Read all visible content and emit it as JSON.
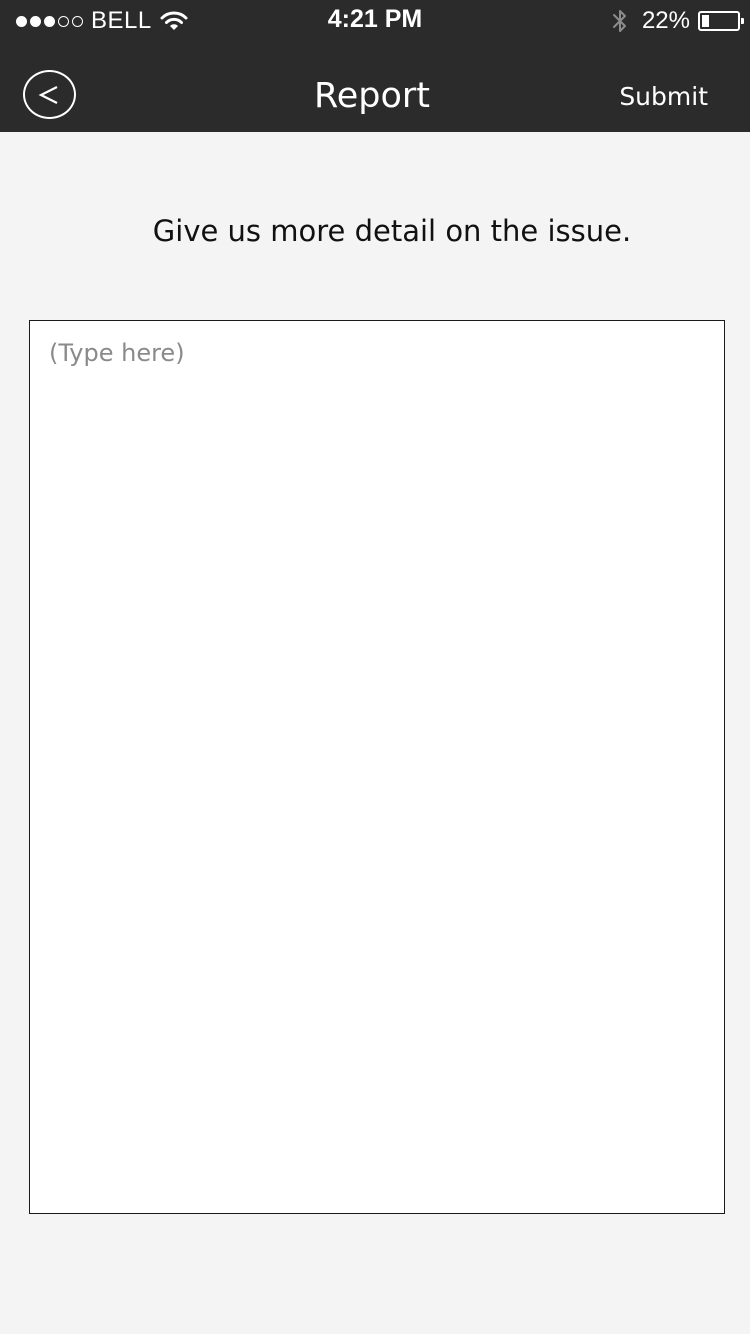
{
  "status_bar": {
    "signal_filled": 3,
    "signal_total": 5,
    "carrier": "BELL",
    "time": "4:21 PM",
    "battery_percent": "22%",
    "battery_level": 0.22,
    "icons": [
      "signal-dots-icon",
      "wifi-icon",
      "bluetooth-icon",
      "battery-icon"
    ]
  },
  "nav": {
    "back_icon": "chevron-left-icon",
    "title": "Report",
    "submit_label": "Submit"
  },
  "main": {
    "prompt": "Give us more detail on the issue.",
    "detail_placeholder": "(Type here)",
    "detail_value": ""
  },
  "colors": {
    "topbar_bg": "#2b2b2b",
    "page_bg": "#f4f4f5",
    "field_bg": "#ffffff",
    "field_border": "#1a1a1a",
    "placeholder": "#8a8a8a"
  }
}
